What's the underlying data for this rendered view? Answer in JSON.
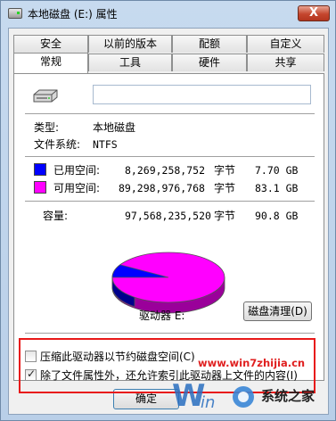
{
  "window": {
    "title": "本地磁盘 (E:) 属性",
    "close_label": "X"
  },
  "tabs": {
    "row1": [
      "安全",
      "以前的版本",
      "配额",
      "自定义"
    ],
    "row2": [
      "常规",
      "工具",
      "硬件",
      "共享"
    ],
    "active": "常规"
  },
  "general": {
    "name_value": "",
    "type_label": "类型:",
    "type_value": "本地磁盘",
    "fs_label": "文件系统:",
    "fs_value": "NTFS",
    "used": {
      "label": "已用空间:",
      "bytes": "8,269,258,752",
      "unit": "字节",
      "size": "7.70 GB",
      "color": "#0000ff"
    },
    "free": {
      "label": "可用空间:",
      "bytes": "89,298,976,768",
      "unit": "字节",
      "size": "83.1 GB",
      "color": "#ff00ff"
    },
    "capacity": {
      "label": "容量:",
      "bytes": "97,568,235,520",
      "unit": "字节",
      "size": "90.8 GB"
    },
    "drive_label": "驱动器 E:",
    "cleanup_button": "磁盘清理(D)",
    "used_fraction": 0.0848
  },
  "options": {
    "compress": {
      "label": "压缩此驱动器以节约磁盘空间(C)",
      "checked": false
    },
    "index": {
      "label": "除了文件属性外，还允许索引此驱动器上文件的内容(I)",
      "checked": true
    }
  },
  "buttons": {
    "ok": "确定"
  },
  "watermark": {
    "url": "www.win7zhijia.cn",
    "text": "系统之家"
  }
}
